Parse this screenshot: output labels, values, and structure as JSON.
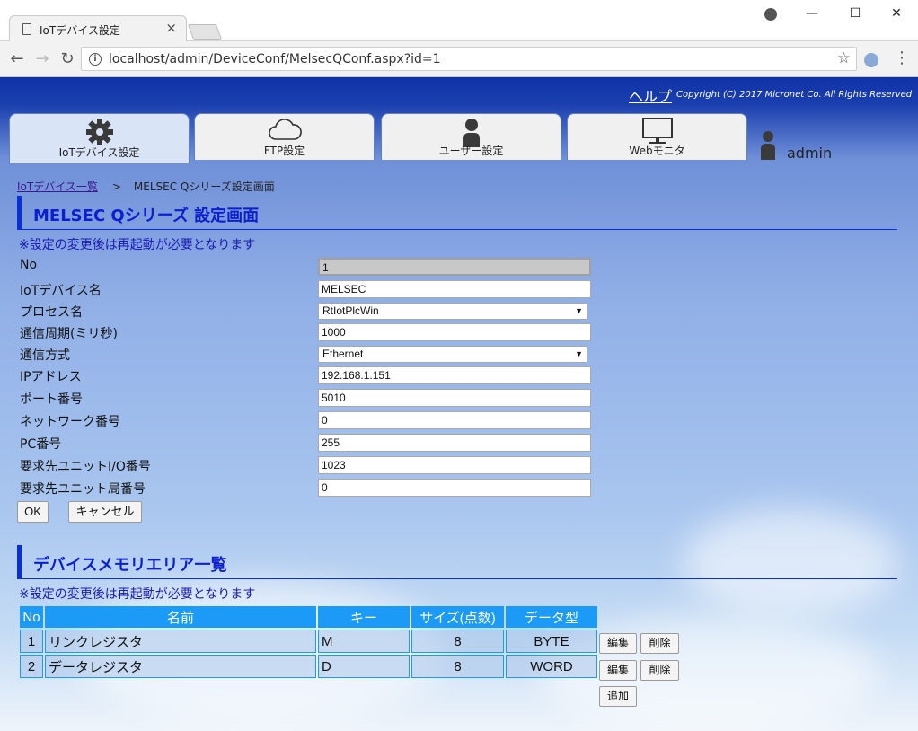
{
  "browser": {
    "tab_title": "IoTデバイス設定",
    "url": "localhost/admin/DeviceConf/MelsecQConf.aspx?id=1",
    "win_min": "—",
    "win_max": "☐",
    "win_close": "✕",
    "icons": [
      "doc-icon",
      "close-icon",
      "account-icon",
      "back-icon",
      "forward-icon",
      "reload-icon",
      "info-icon",
      "star-icon",
      "extension-icon",
      "menu-icon"
    ]
  },
  "header": {
    "help": "ヘルプ",
    "copyright": "Copyright (C) 2017 Micronet Co. All Rights Reserved"
  },
  "nav_tabs": [
    {
      "label": "IoTデバイス設定",
      "icon": "gear-icon",
      "active": true
    },
    {
      "label": "FTP設定",
      "icon": "cloud-icon",
      "active": false
    },
    {
      "label": "ユーザー設定",
      "icon": "user-icon",
      "active": false
    },
    {
      "label": "Webモニタ",
      "icon": "monitor-icon",
      "active": false
    }
  ],
  "user": {
    "name": "admin"
  },
  "breadcrumb": {
    "link": "IoTデバイス一覧",
    "separator": ">",
    "current": "MELSEC Qシリーズ設定画面"
  },
  "settings": {
    "title": "MELSEC Qシリーズ 設定画面",
    "note": "※設定の変更後は再起動が必要となります",
    "fields": [
      {
        "label": "No",
        "value": "1"
      },
      {
        "label": "IoTデバイス名",
        "value": "MELSEC"
      },
      {
        "label": "プロセス名",
        "value": "RtIotPlcWin"
      },
      {
        "label": "通信周期(ミリ秒)",
        "value": "1000"
      },
      {
        "label": "通信方式",
        "value": "Ethernet"
      },
      {
        "label": "IPアドレス",
        "value": "192.168.1.151"
      },
      {
        "label": "ポート番号",
        "value": "5010"
      },
      {
        "label": "ネットワーク番号",
        "value": "0"
      },
      {
        "label": "PC番号",
        "value": "255"
      },
      {
        "label": "要求先ユニットI/O番号",
        "value": "1023"
      },
      {
        "label": "要求先ユニット局番号",
        "value": "0"
      }
    ],
    "ok_label": "OK",
    "cancel_label": "キャンセル"
  },
  "memory": {
    "title": "デバイスメモリエリア一覧",
    "note": "※設定の変更後は再起動が必要となります",
    "columns": [
      "No",
      "名前",
      "キー",
      "サイズ(点数)",
      "データ型"
    ],
    "rows": [
      {
        "no": "1",
        "name": "リンクレジスタ",
        "key": "M",
        "size": "8",
        "type": "BYTE"
      },
      {
        "no": "2",
        "name": "データレジスタ",
        "key": "D",
        "size": "8",
        "type": "WORD"
      }
    ],
    "edit_label": "編集",
    "delete_label": "削除",
    "add_label": "追加"
  },
  "colors": {
    "accent": "#0b2fd6",
    "table_header": "#1b9bf5",
    "header_bg": "#1033a8"
  }
}
